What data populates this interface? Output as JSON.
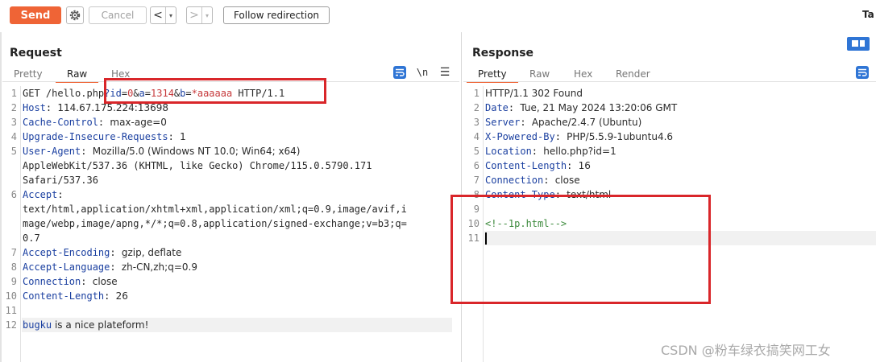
{
  "toolbar": {
    "send_label": "Send",
    "cancel_label": "Cancel",
    "back_label": "<",
    "forward_label": ">",
    "dropdown_glyph": "▾",
    "follow_label": "Follow redirection",
    "target_label": "Ta",
    "icons": [
      "gear-icon"
    ]
  },
  "request": {
    "title": "Request",
    "tabs": [
      "Pretty",
      "Raw",
      "Hex"
    ],
    "active_tab": "Raw",
    "newline_toggle": "\\n",
    "menu_glyph": "☰",
    "lines": [
      {
        "n": "1",
        "segments": [
          [
            "plain",
            "GET /hello.php"
          ],
          [
            "pk",
            "?id"
          ],
          [
            "plain",
            "="
          ],
          [
            "pv",
            "0"
          ],
          [
            "plain",
            "&"
          ],
          [
            "pk",
            "a"
          ],
          [
            "plain",
            "="
          ],
          [
            "pv",
            "1314"
          ],
          [
            "plain",
            "&"
          ],
          [
            "pk",
            "b"
          ],
          [
            "plain",
            "="
          ],
          [
            "pv",
            "*aaaaaa"
          ],
          [
            "plain",
            " HTTP/1.1"
          ]
        ]
      },
      {
        "n": "2",
        "key": "Host",
        "value": "114.67.175.224:13698"
      },
      {
        "n": "3",
        "key": "Cache-Control",
        "value": "max-age=0"
      },
      {
        "n": "4",
        "key": "Upgrade-Insecure-Requests",
        "value": "1"
      },
      {
        "n": "5",
        "key": "User-Agent",
        "value": "Mozilla/5.0 (Windows NT 10.0; Win64; x64)"
      },
      {
        "n": "",
        "cont": "AppleWebKit/537.36 (KHTML, like Gecko) Chrome/115.0.5790.171"
      },
      {
        "n": "",
        "cont": "Safari/537.36"
      },
      {
        "n": "6",
        "key": "Accept",
        "value": ""
      },
      {
        "n": "",
        "cont": "text/html,application/xhtml+xml,application/xml;q=0.9,image/avif,i"
      },
      {
        "n": "",
        "cont": "mage/webp,image/apng,*/*;q=0.8,application/signed-exchange;v=b3;q="
      },
      {
        "n": "",
        "cont": "0.7"
      },
      {
        "n": "7",
        "key": "Accept-Encoding",
        "value": "gzip, deflate"
      },
      {
        "n": "8",
        "key": "Accept-Language",
        "value": "zh-CN,zh;q=0.9"
      },
      {
        "n": "9",
        "key": "Connection",
        "value": "close"
      },
      {
        "n": "10",
        "key": "Content-Length",
        "value": "26"
      },
      {
        "n": "11",
        "cont": ""
      },
      {
        "n": "12",
        "body_key": "bugku",
        "body_rest": " is a nice plateform!"
      }
    ]
  },
  "response": {
    "title": "Response",
    "tabs": [
      "Pretty",
      "Raw",
      "Hex",
      "Render"
    ],
    "active_tab": "Pretty",
    "lines": [
      {
        "n": "1",
        "plain": "HTTP/1.1 302 Found"
      },
      {
        "n": "2",
        "key": "Date",
        "value": "Tue, 21 May 2024 13:20:06 GMT"
      },
      {
        "n": "3",
        "key": "Server",
        "value": "Apache/2.4.7 (Ubuntu)"
      },
      {
        "n": "4",
        "key": "X-Powered-By",
        "value": "PHP/5.5.9-1ubuntu4.6"
      },
      {
        "n": "5",
        "key": "Location",
        "value": "hello.php?id=1"
      },
      {
        "n": "6",
        "key": "Content-Length",
        "value": "16"
      },
      {
        "n": "7",
        "key": "Connection",
        "value": "close"
      },
      {
        "n": "8",
        "key": "Content-Type",
        "value": "text/html"
      },
      {
        "n": "9",
        "plain": ""
      },
      {
        "n": "10",
        "comment": "<!--1p.html-->"
      },
      {
        "n": "11",
        "plain": ""
      }
    ]
  },
  "watermark": "CSDN @粉车绿衣搞笑网工女"
}
